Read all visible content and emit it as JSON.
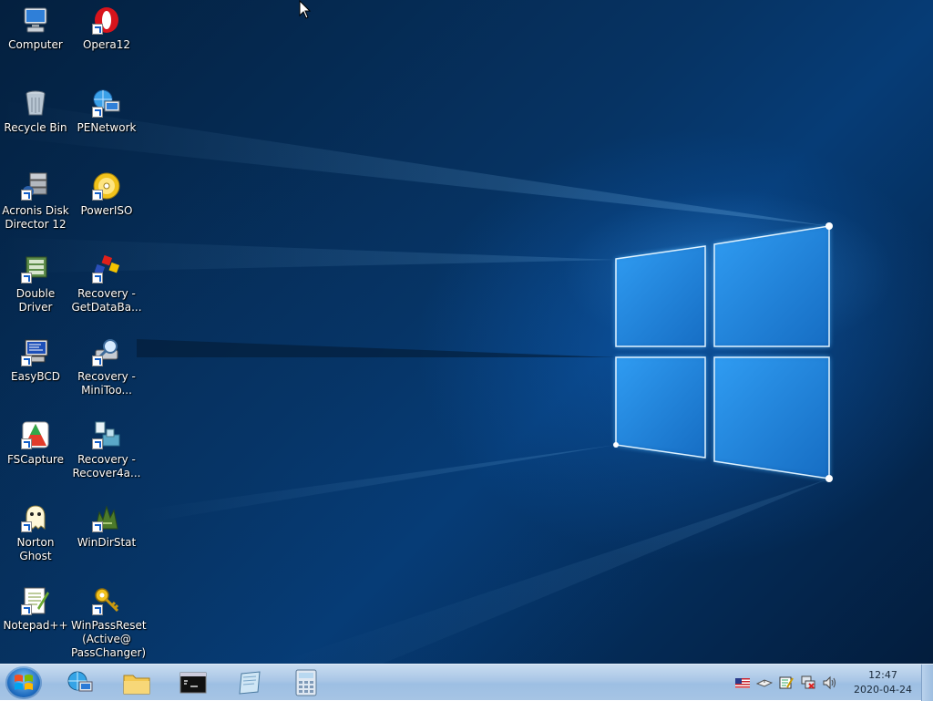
{
  "desktop": {
    "icons": [
      {
        "label": "Computer",
        "icon": "computer-icon"
      },
      {
        "label": "Opera12",
        "icon": "opera-icon"
      },
      {
        "label": "Recycle Bin",
        "icon": "recycle-bin-icon"
      },
      {
        "label": "PENetwork",
        "icon": "network-icon"
      },
      {
        "label": "Acronis Disk\nDirector 12",
        "icon": "acronis-icon"
      },
      {
        "label": "PowerISO",
        "icon": "poweriso-icon"
      },
      {
        "label": "Double Driver",
        "icon": "double-driver-icon"
      },
      {
        "label": "Recovery -\nGetDataBa...",
        "icon": "getdataback-icon"
      },
      {
        "label": "EasyBCD",
        "icon": "easybcd-icon"
      },
      {
        "label": "Recovery -\nMiniToo...",
        "icon": "minitool-icon"
      },
      {
        "label": "FSCapture",
        "icon": "fscapture-icon"
      },
      {
        "label": "Recovery -\nRecover4a...",
        "icon": "recover4all-icon"
      },
      {
        "label": "Norton Ghost",
        "icon": "ghost-icon"
      },
      {
        "label": "WinDirStat",
        "icon": "windirstat-icon"
      },
      {
        "label": "Notepad++",
        "icon": "notepadpp-icon"
      },
      {
        "label": "WinPassReset\n(Active@\nPassChanger)",
        "icon": "key-icon"
      }
    ]
  },
  "taskbar": {
    "pinned": [
      "network-globe-icon",
      "folder-icon",
      "command-prompt-icon",
      "notepad-icon",
      "calculator-icon"
    ],
    "tray": [
      "us-flag-icon",
      "usb-drive-icon",
      "edit-tool-icon",
      "network-status-icon",
      "volume-icon"
    ],
    "clock_time": "12:47",
    "clock_date": "2020-04-24"
  },
  "colors": {
    "wallpaper_dark": "#031d3d",
    "wallpaper_glow": "#1e8cf0",
    "taskbar": "#a9c6e6"
  }
}
